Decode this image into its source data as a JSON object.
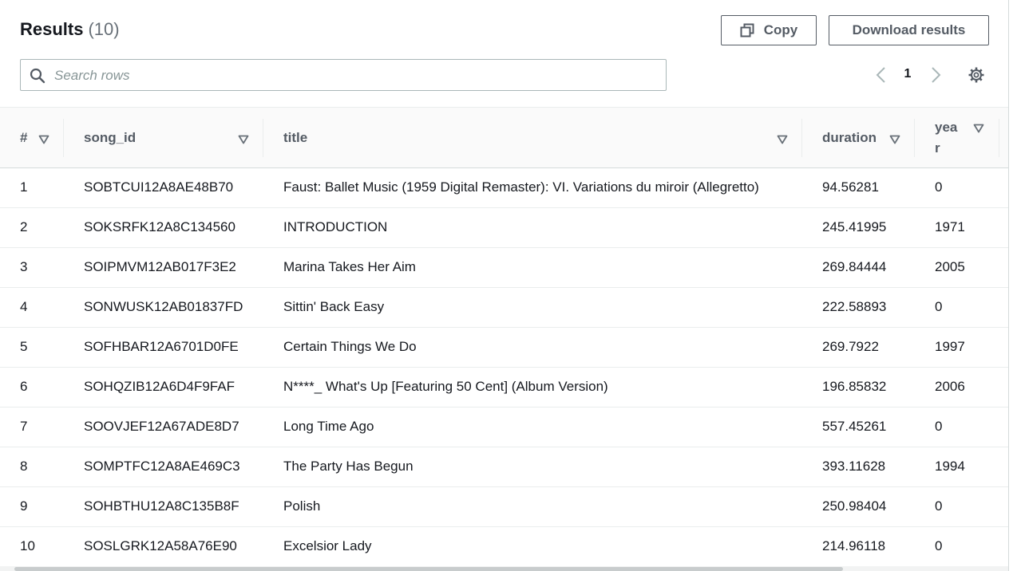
{
  "header": {
    "title": "Results",
    "count": "(10)",
    "copy_label": "Copy",
    "download_label": "Download results"
  },
  "search": {
    "placeholder": "Search rows"
  },
  "pagination": {
    "current_page": "1"
  },
  "table": {
    "columns": [
      "#",
      "song_id",
      "title",
      "duration",
      "yea",
      "r"
    ],
    "rows": [
      {
        "num": "1",
        "song_id": "SOBTCUI12A8AE48B70",
        "title": "Faust: Ballet Music (1959 Digital Remaster): VI. Variations du miroir (Allegretto)",
        "duration": "94.56281",
        "year": "0"
      },
      {
        "num": "2",
        "song_id": "SOKSRFK12A8C134560",
        "title": "INTRODUCTION",
        "duration": "245.41995",
        "year": "1971"
      },
      {
        "num": "3",
        "song_id": "SOIPMVM12AB017F3E2",
        "title": "Marina Takes Her Aim",
        "duration": "269.84444",
        "year": "2005"
      },
      {
        "num": "4",
        "song_id": "SONWUSK12AB01837FD",
        "title": "Sittin' Back Easy",
        "duration": "222.58893",
        "year": "0"
      },
      {
        "num": "5",
        "song_id": "SOFHBAR12A6701D0FE",
        "title": "Certain Things We Do",
        "duration": "269.7922",
        "year": "1997"
      },
      {
        "num": "6",
        "song_id": "SOHQZIB12A6D4F9FAF",
        "title": "N****_ What's Up [Featuring 50 Cent] (Album Version)",
        "duration": "196.85832",
        "year": "2006"
      },
      {
        "num": "7",
        "song_id": "SOOVJEF12A67ADE8D7",
        "title": "Long Time Ago",
        "duration": "557.45261",
        "year": "0"
      },
      {
        "num": "8",
        "song_id": "SOMPTFC12A8AE469C3",
        "title": "The Party Has Begun",
        "duration": "393.11628",
        "year": "1994"
      },
      {
        "num": "9",
        "song_id": "SOHBTHU12A8C135B8F",
        "title": "Polish",
        "duration": "250.98404",
        "year": "0"
      },
      {
        "num": "10",
        "song_id": "SOSLGRK12A58A76E90",
        "title": "Excelsior Lady",
        "duration": "214.96118",
        "year": "0"
      }
    ]
  },
  "icons": {
    "copy": "copy-icon",
    "search": "search-icon",
    "prev": "chevron-left-icon",
    "next": "chevron-right-icon",
    "settings": "gear-icon",
    "sort": "caret-down-icon"
  },
  "colors": {
    "text": "#16191f",
    "muted": "#545b64",
    "border": "#d5dbdb",
    "header_bg": "#fafafa"
  }
}
